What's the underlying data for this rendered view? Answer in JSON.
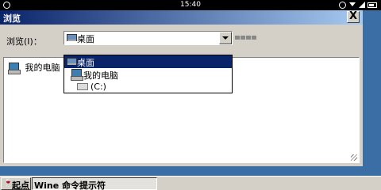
{
  "statusbar": {
    "time": "15:40"
  },
  "window": {
    "title": "浏览",
    "close_label": "X"
  },
  "browse": {
    "label": "浏览(I)：",
    "selected": "桌面"
  },
  "dropdown": {
    "items": [
      {
        "label": "桌面",
        "icon": "desktop-icon"
      },
      {
        "label": "我的电脑",
        "icon": "computer-icon"
      },
      {
        "label": "(C:)",
        "icon": "drive-icon"
      }
    ]
  },
  "filelist": {
    "items": [
      {
        "label": "我的电脑",
        "icon": "computer-icon"
      }
    ]
  },
  "taskbar": {
    "start_label": "起点",
    "task_label": "Wine 命令提示符"
  },
  "colors": {
    "desktop": "#3a6ea5",
    "selection": "#0a246a",
    "face": "#d4d0c8"
  }
}
